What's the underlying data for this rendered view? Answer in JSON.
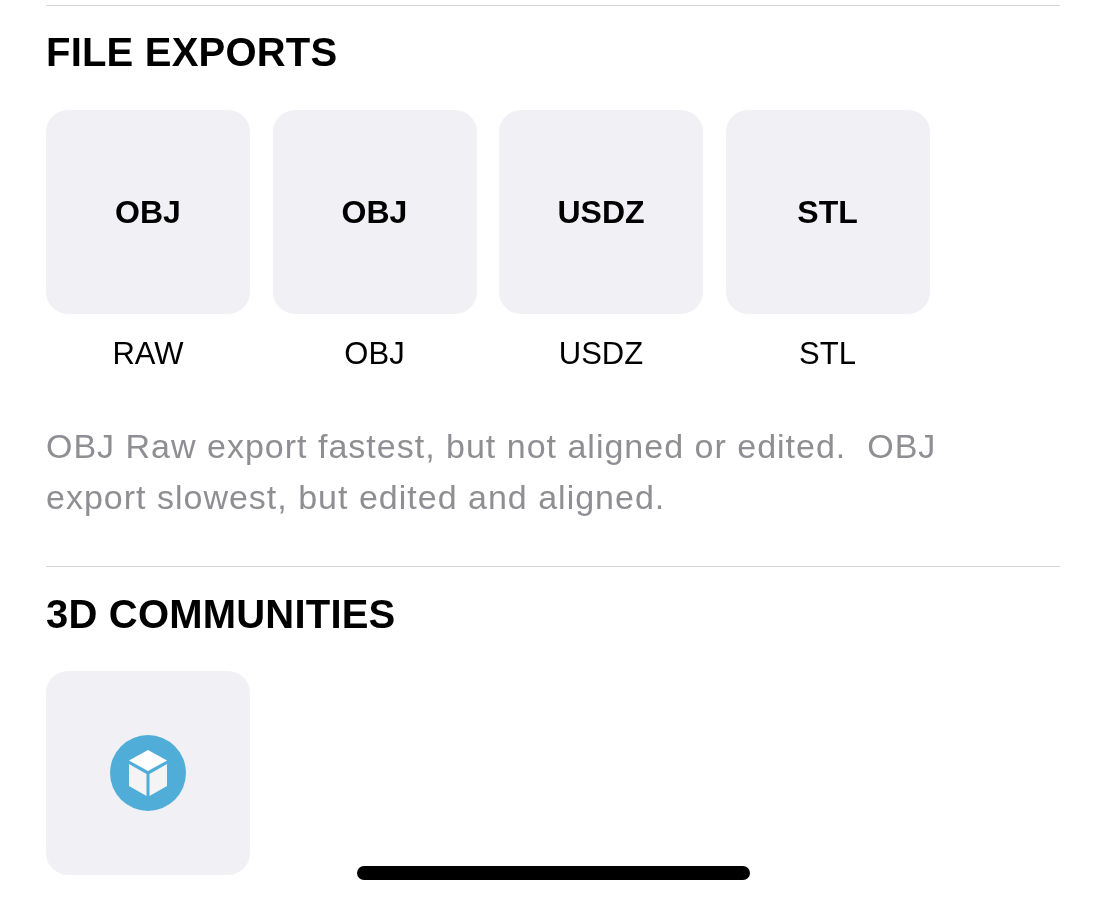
{
  "sections": [
    {
      "kind": "exports",
      "title": "FILE EXPORTS",
      "tiles": [
        {
          "kind": "text",
          "label": "OBJ",
          "caption": "RAW"
        },
        {
          "kind": "text",
          "label": "OBJ",
          "caption": "OBJ"
        },
        {
          "kind": "text",
          "label": "USDZ",
          "caption": "USDZ"
        },
        {
          "kind": "text",
          "label": "STL",
          "caption": "STL"
        }
      ],
      "note": "OBJ Raw export fastest, but not aligned or edited.  OBJ export slowest, but edited and aligned."
    },
    {
      "kind": "communities",
      "title": "3D COMMUNITIES",
      "tiles": [
        {
          "kind": "logo"
        }
      ]
    }
  ]
}
